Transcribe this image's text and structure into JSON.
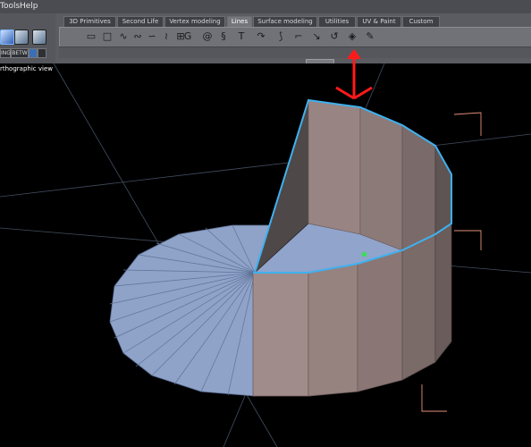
{
  "menubar": {
    "tools": "Tools",
    "help": "Help"
  },
  "toolbar": {
    "tabs": [
      {
        "label": "3D Primitives"
      },
      {
        "label": "Second Life"
      },
      {
        "label": "Vertex modeling"
      },
      {
        "label": "Lines"
      },
      {
        "label": "Surface modeling"
      },
      {
        "label": "Utilities"
      },
      {
        "label": "UV & Paint"
      },
      {
        "label": "Custom"
      }
    ],
    "active_tab": "Lines",
    "left_buttons": {
      "btn1": "ING",
      "btn2": "BETW"
    },
    "icons": [
      "rectangle-icon",
      "rectangle-outline-icon",
      "wave-icon",
      "spiral-line-icon",
      "helix-icon",
      "zigzag-icon",
      "grid-pattern-icon",
      "circle-arrow-icon",
      "spiral-icon",
      "coil-icon",
      "text-icon",
      "hook-icon",
      "bracket-icon",
      "bend-icon",
      "path-icon",
      "tool-a-icon",
      "tool-b-icon",
      "tool-c-icon"
    ]
  },
  "viewport": {
    "label": "rthographic view"
  },
  "colors": {
    "accent": "#3fb1f0",
    "arrow": "#ff1a1a",
    "wall": "#8f7c7a",
    "disc": "#8fa3c9"
  }
}
